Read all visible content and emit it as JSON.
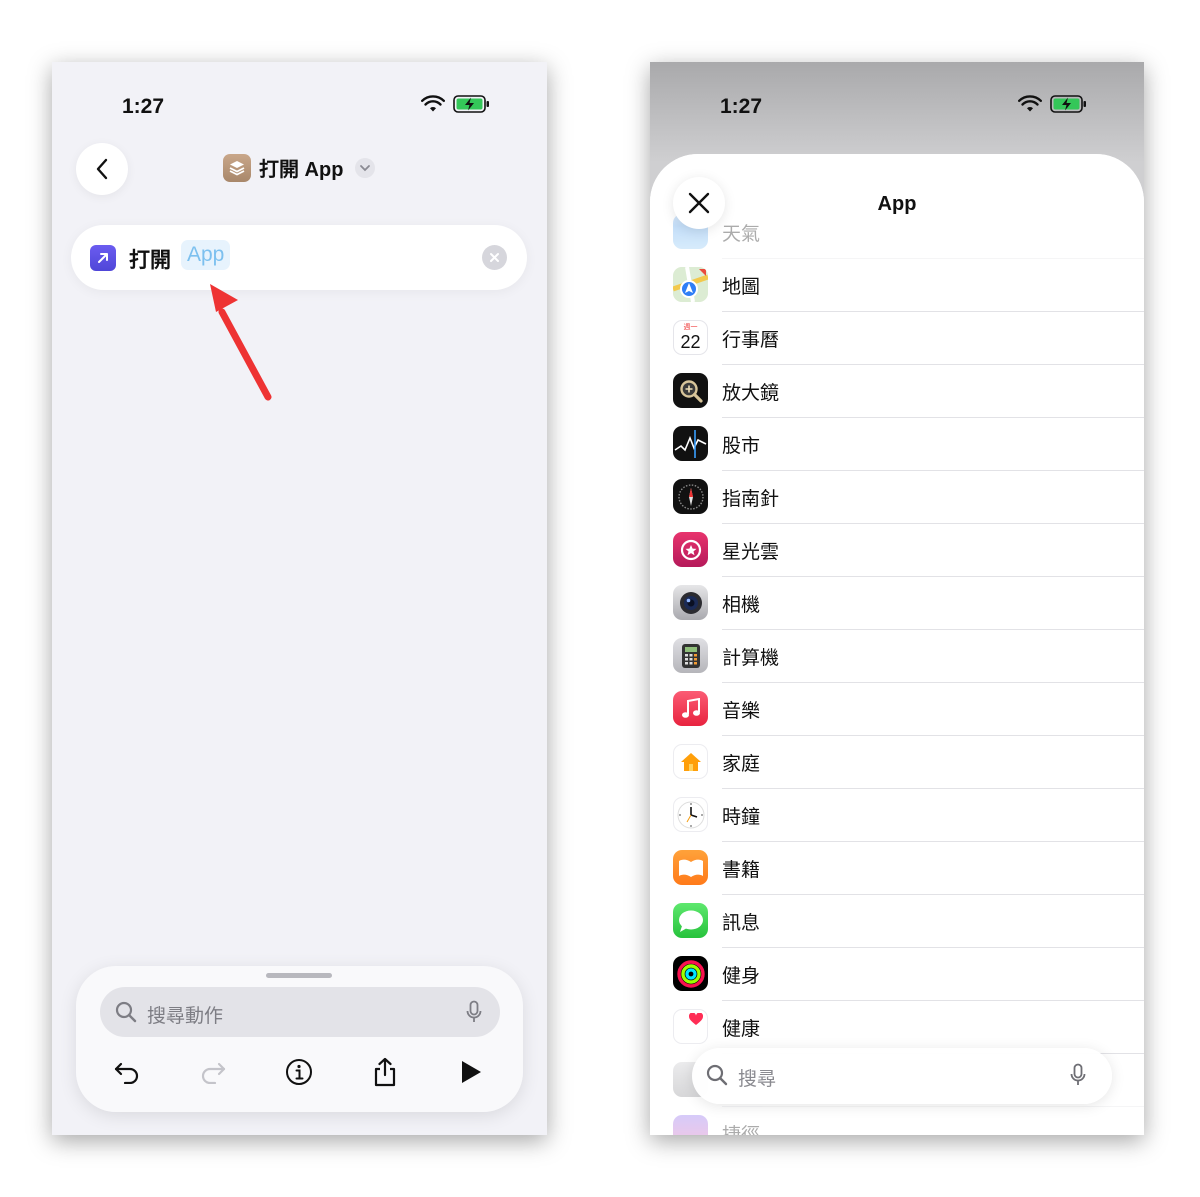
{
  "left_screen": {
    "status": {
      "time": "1:27"
    },
    "header": {
      "title": "打開 App"
    },
    "action": {
      "label": "打開",
      "token": "App"
    },
    "search": {
      "placeholder": "搜尋動作"
    }
  },
  "right_screen": {
    "status": {
      "time": "1:27"
    },
    "sheet": {
      "title": "App"
    },
    "apps": [
      {
        "name": "天氣",
        "icon": "weather-icon"
      },
      {
        "name": "地圖",
        "icon": "maps-icon"
      },
      {
        "name": "行事曆",
        "icon": "calendar-icon",
        "calendar_weekday": "週一",
        "calendar_day": "22"
      },
      {
        "name": "放大鏡",
        "icon": "magnifier-icon"
      },
      {
        "name": "股市",
        "icon": "stocks-icon"
      },
      {
        "name": "指南針",
        "icon": "compass-icon"
      },
      {
        "name": "星光雲",
        "icon": "starcloud-icon"
      },
      {
        "name": "相機",
        "icon": "camera-icon"
      },
      {
        "name": "計算機",
        "icon": "calculator-icon"
      },
      {
        "name": "音樂",
        "icon": "music-icon"
      },
      {
        "name": "家庭",
        "icon": "home-icon"
      },
      {
        "name": "時鐘",
        "icon": "clock-icon"
      },
      {
        "name": "書籍",
        "icon": "books-icon"
      },
      {
        "name": "訊息",
        "icon": "messages-icon"
      },
      {
        "name": "健身",
        "icon": "fitness-icon"
      },
      {
        "name": "健康",
        "icon": "health-icon"
      },
      {
        "name": "",
        "icon": "app-icon"
      },
      {
        "name": "捷徑",
        "icon": "shortcuts-icon"
      }
    ],
    "search": {
      "placeholder": "搜尋"
    }
  },
  "colors": {
    "token_text": "#7cc0ef",
    "token_bg": "#e7f3fd",
    "annotation_arrow": "#ee3333",
    "battery_charge": "#34c759"
  }
}
